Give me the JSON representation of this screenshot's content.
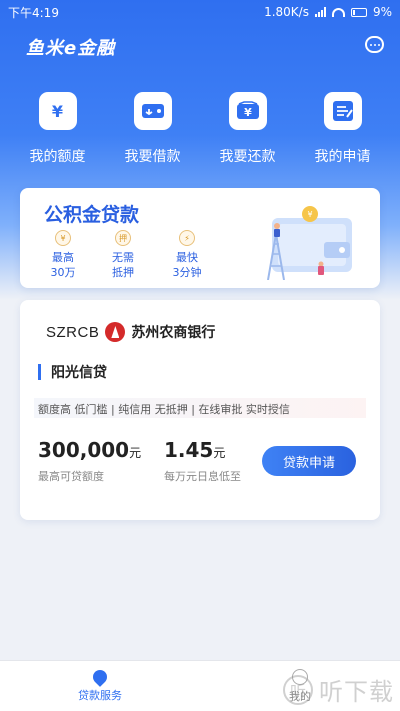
{
  "status_bar": {
    "time": "下午4:19",
    "speed": "1.80K/s",
    "battery": "9%"
  },
  "header": {
    "logo": "鱼米e金融"
  },
  "quick_nav": [
    {
      "label": "我的额度",
      "icon": "yuan-icon"
    },
    {
      "label": "我要借款",
      "icon": "wallet-icon"
    },
    {
      "label": "我要还款",
      "icon": "yuan-card-icon"
    },
    {
      "label": "我的申请",
      "icon": "document-icon"
    }
  ],
  "banner": {
    "title": "公积金贷款",
    "features": [
      {
        "icon": "¥",
        "line1": "最高",
        "line2": "30万"
      },
      {
        "icon": "押",
        "line1": "无需",
        "line2": "抵押"
      },
      {
        "icon": "⚡",
        "line1": "最快",
        "line2": "3分钟"
      }
    ]
  },
  "loan_card": {
    "bank_code": "SZRCB",
    "bank_name": "苏州农商银行",
    "product_name": "阳光信贷",
    "tags": "额度高 低门槛 | 纯信用 无抵押 | 在线审批 实时授信",
    "amount": "300,000",
    "amount_unit": "元",
    "amount_label": "最高可贷额度",
    "rate": "1.45",
    "rate_unit": "元",
    "rate_label": "每万元日息低至",
    "apply_label": "贷款申请"
  },
  "tabbar": {
    "tabs": [
      {
        "label": "贷款服务",
        "active": true
      },
      {
        "label": "我的",
        "active": false
      }
    ]
  },
  "watermark": {
    "badge": "听",
    "text": "听下载"
  },
  "colors": {
    "primary": "#2f6ff0",
    "banner_title": "#2a5fe0",
    "bank_red": "#d42a2a"
  }
}
